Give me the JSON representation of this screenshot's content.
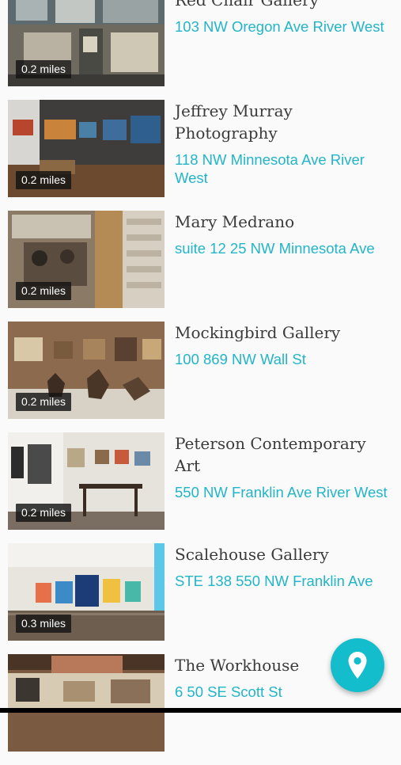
{
  "galleries": [
    {
      "name": "Red Chair Gallery",
      "address": "103 NW Oregon Ave River West",
      "distance": "0.2 miles"
    },
    {
      "name": "Jeffrey Murray Photography",
      "address": "118 NW Minnesota Ave River West",
      "distance": "0.2 miles"
    },
    {
      "name": "Mary Medrano",
      "address": "suite 12 25 NW Minnesota Ave",
      "distance": "0.2 miles"
    },
    {
      "name": "Mockingbird Gallery",
      "address": "100 869 NW Wall St",
      "distance": "0.2 miles"
    },
    {
      "name": "Peterson Contemporary Art",
      "address": "550 NW Franklin Ave River West",
      "distance": "0.2 miles"
    },
    {
      "name": "Scalehouse Gallery",
      "address": "STE 138 550 NW Franklin Ave",
      "distance": "0.3 miles"
    },
    {
      "name": "The Workhouse",
      "address": "6 50 SE Scott St",
      "distance": ""
    }
  ],
  "map_button": {
    "icon": "map-pin-icon",
    "color": "#14bdcc"
  },
  "accent_color": "#22b5c8"
}
